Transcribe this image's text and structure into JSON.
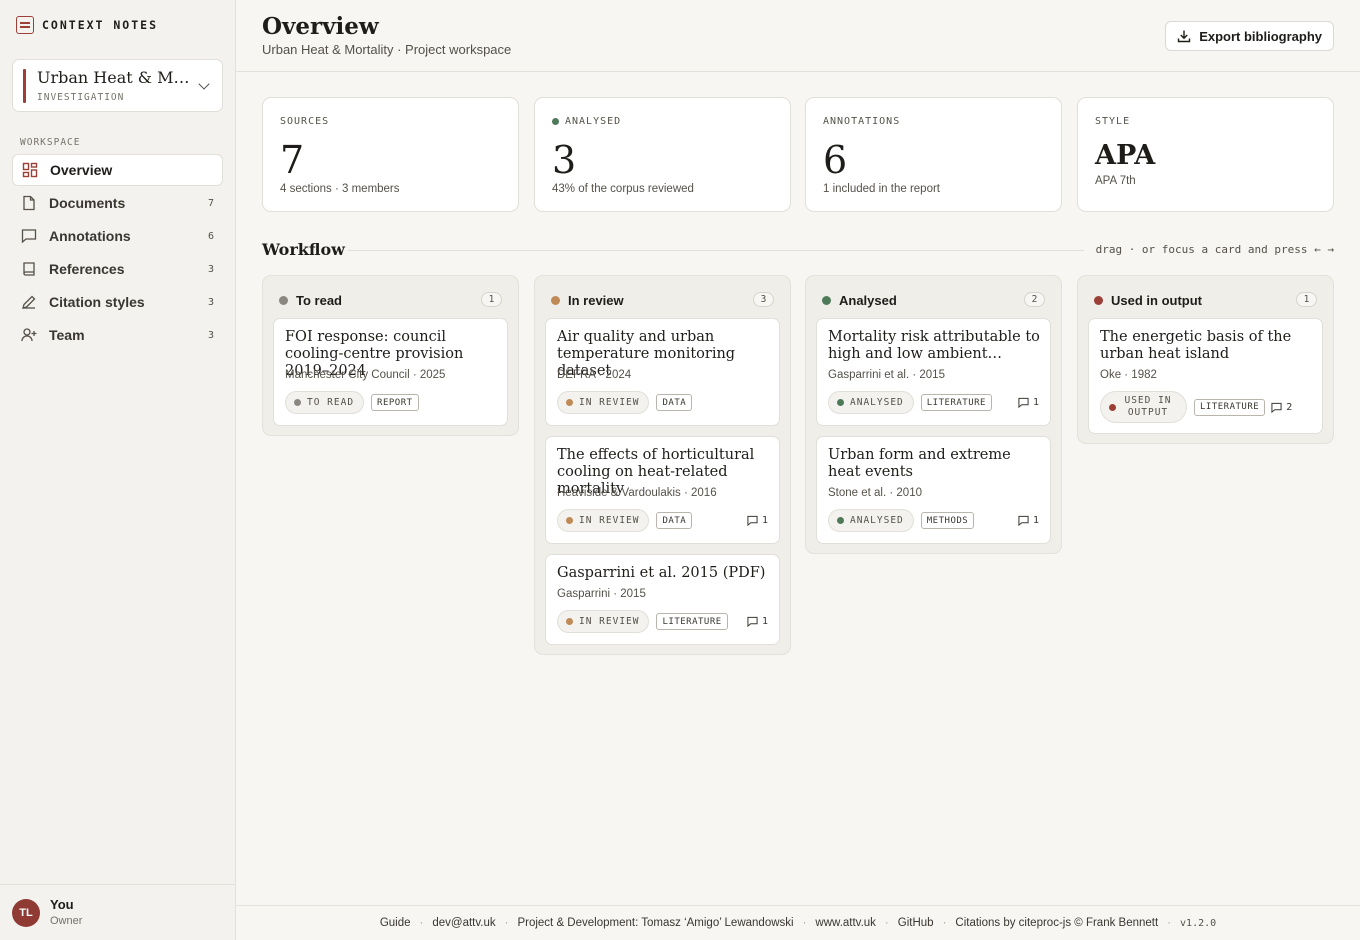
{
  "brand": {
    "label": "CONTEXT NOTES"
  },
  "project": {
    "name": "Urban Heat & Mortality",
    "type": "INVESTIGATION"
  },
  "sidebar": {
    "section_label": "WORKSPACE",
    "items": [
      {
        "label": "Overview",
        "count": "",
        "icon": "grid-icon"
      },
      {
        "label": "Documents",
        "count": "7",
        "icon": "document-icon"
      },
      {
        "label": "Annotations",
        "count": "6",
        "icon": "comment-icon"
      },
      {
        "label": "References",
        "count": "3",
        "icon": "book-icon"
      },
      {
        "label": "Citation styles",
        "count": "3",
        "icon": "pen-icon"
      },
      {
        "label": "Team",
        "count": "3",
        "icon": "user-add-icon"
      }
    ]
  },
  "user": {
    "initials": "TL",
    "name": "You",
    "role": "Owner"
  },
  "header": {
    "title": "Overview",
    "subtitle": "Urban Heat & Mortality · Project workspace",
    "export_label": "Export bibliography"
  },
  "stats": [
    {
      "label": "SOURCES",
      "value": "7",
      "note": "4 sections · 3 members"
    },
    {
      "label": "ANALYSED",
      "value": "3",
      "note": "43% of the corpus reviewed",
      "dot_color": "#4e7a59"
    },
    {
      "label": "ANNOTATIONS",
      "value": "6",
      "note": "1 included in the report"
    },
    {
      "label": "STYLE",
      "value": "APA",
      "note": "APA 7th"
    }
  ],
  "workflow": {
    "title": "Workflow",
    "hint": "drag · or focus a card and press ← →",
    "columns": [
      {
        "name": "To read",
        "count": "1",
        "color": "#8a8780",
        "cards": [
          {
            "title": "FOI response: council cooling-centre provision 2019–2024",
            "meta": "Manchester City Council · 2025",
            "status": "TO READ",
            "tag": "REPORT",
            "comments": ""
          }
        ]
      },
      {
        "name": "In review",
        "count": "3",
        "color": "#c08a56",
        "cards": [
          {
            "title": "Air quality and urban temperature monitoring dataset",
            "meta": "DEFRA · 2024",
            "status": "IN REVIEW",
            "tag": "DATA",
            "comments": ""
          },
          {
            "title": "The effects of horticultural cooling on heat-related mortality",
            "meta": "Heaviside & Vardoulakis · 2016",
            "status": "IN REVIEW",
            "tag": "DATA",
            "comments": "1"
          },
          {
            "title": "Gasparrini et al. 2015 (PDF)",
            "meta": "Gasparrini · 2015",
            "status": "IN REVIEW",
            "tag": "LITERATURE",
            "comments": "1"
          }
        ]
      },
      {
        "name": "Analysed",
        "count": "2",
        "color": "#4e7a59",
        "cards": [
          {
            "title": "Mortality risk attributable to high and low ambient…",
            "meta": "Gasparrini et al. · 2015",
            "status": "ANALYSED",
            "tag": "LITERATURE",
            "comments": "1"
          },
          {
            "title": "Urban form and extreme heat events",
            "meta": "Stone et al. · 2010",
            "status": "ANALYSED",
            "tag": "METHODS",
            "comments": "1"
          }
        ]
      },
      {
        "name": "Used in output",
        "count": "1",
        "color": "#9c3f37",
        "cards": [
          {
            "title": "The energetic basis of the urban heat island",
            "meta": "Oke · 1982",
            "status": "USED IN OUTPUT",
            "tag": "LITERATURE",
            "comments": "2"
          }
        ]
      }
    ]
  },
  "footer": {
    "links": [
      "Guide",
      "dev@attv.uk",
      "Project & Development: Tomasz ‘Amigo’ Lewandowski",
      "www.attv.uk",
      "GitHub",
      "Citations by citeproc-js © Frank Bennett"
    ],
    "version": "v1.2.0"
  }
}
